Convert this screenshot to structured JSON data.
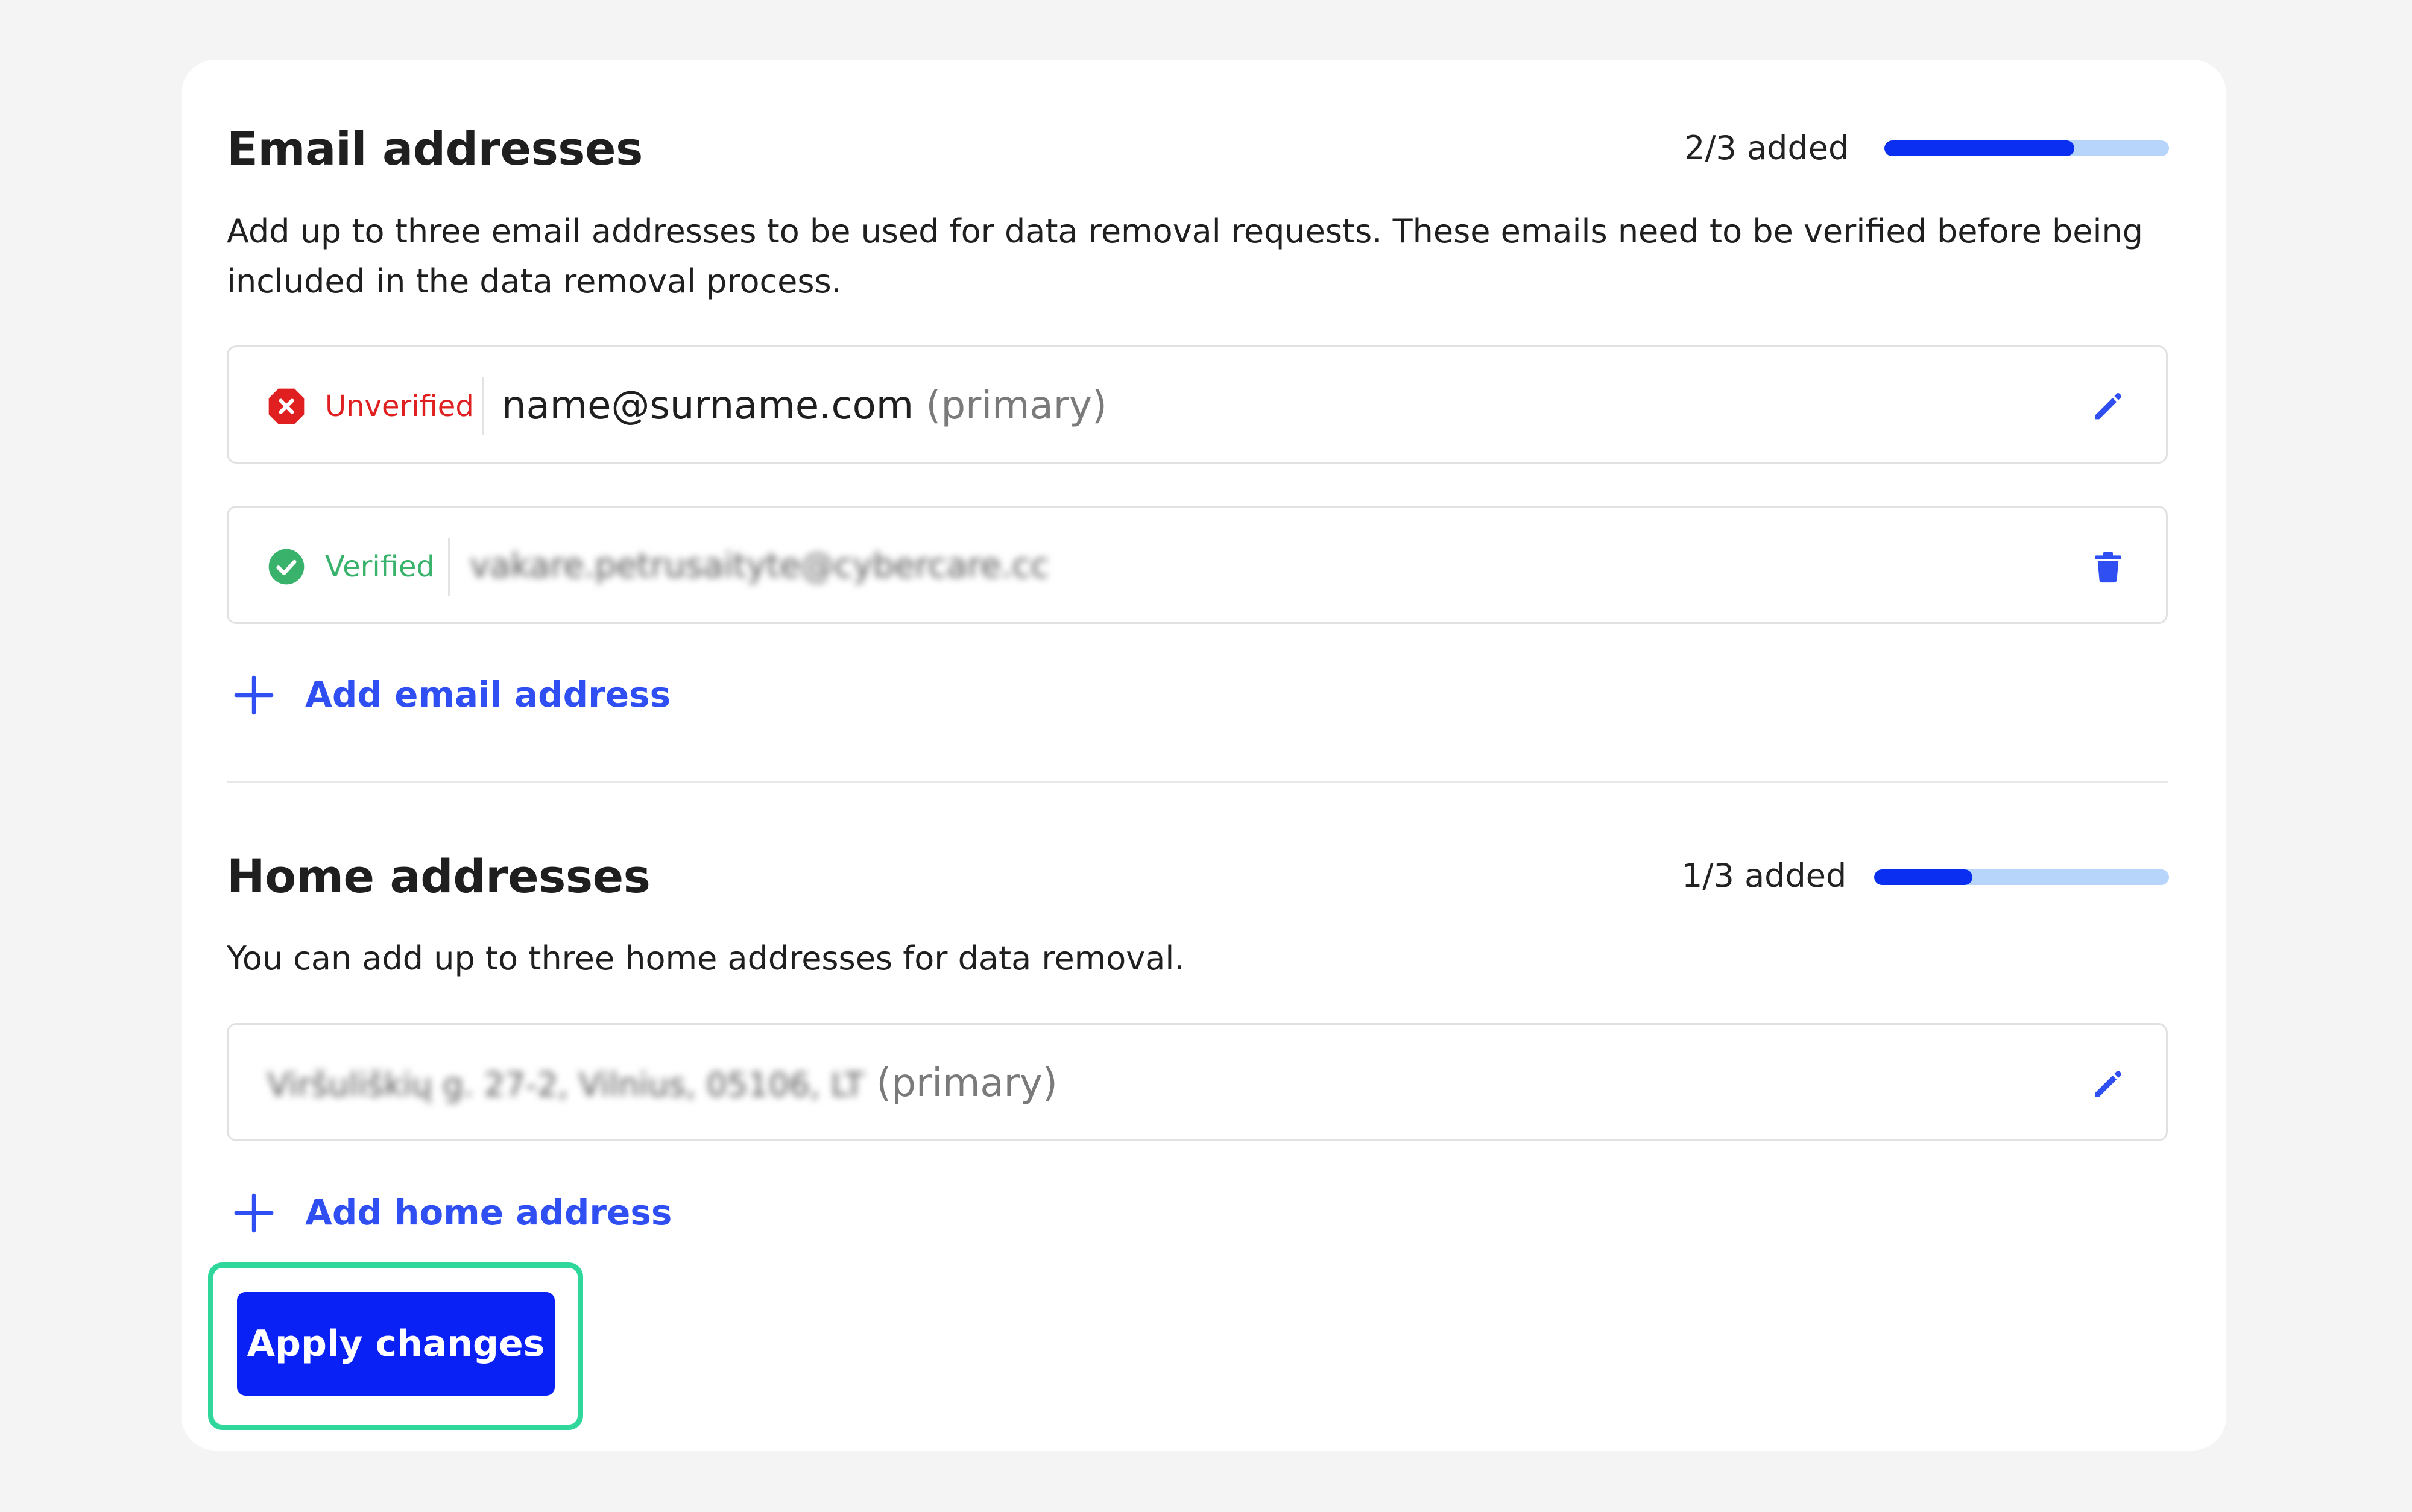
{
  "email_section": {
    "title": "Email addresses",
    "counter": "2/3 added",
    "progress_fraction": 0.667,
    "description": "Add up to three email addresses to be used for data removal requests. These emails need to be verified before being included in the data removal process.",
    "items": [
      {
        "status": "Unverified",
        "status_color": "#e02020",
        "address": "name@surname.com",
        "tag": "(primary)",
        "action_icon": "pencil-icon"
      },
      {
        "status": "Verified",
        "status_color": "#39b36b",
        "address": "vakare.petrusaityte@cybercare.cc",
        "tag": "",
        "action_icon": "trash-icon"
      }
    ],
    "add_label": "Add email address"
  },
  "home_section": {
    "title": "Home addresses",
    "counter": "1/3 added",
    "progress_fraction": 0.333,
    "description": "You can add up to three home addresses for data removal.",
    "items": [
      {
        "address": "Viršuliškių g. 27-2, Vilnius, 05106, LT",
        "tag": "(primary)",
        "action_icon": "pencil-icon"
      }
    ],
    "add_label": "Add home address"
  },
  "apply_button": {
    "label": "Apply changes"
  },
  "colors": {
    "accent": "#2f4ff2",
    "progress_fill": "#0a2ff0",
    "progress_track": "#b7d4fb",
    "button": "#0a21f5",
    "highlight": "#2fd89a"
  }
}
